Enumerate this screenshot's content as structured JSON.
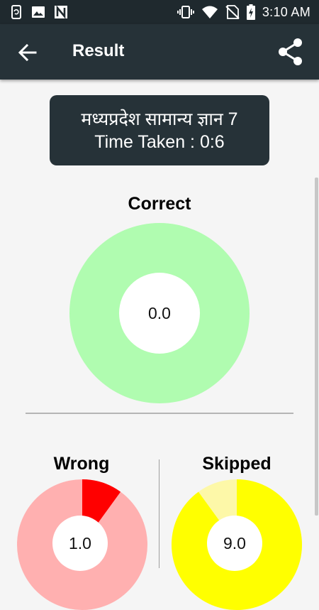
{
  "status_bar": {
    "time": "3:10 AM",
    "left_icons": [
      "phone-sync-icon",
      "image-icon",
      "n-icon"
    ],
    "right_icons": [
      "vibrate-icon",
      "wifi-icon",
      "no-sim-icon",
      "battery-charging-icon"
    ]
  },
  "app_bar": {
    "title": "Result",
    "back_icon": "arrow-back-icon",
    "share_icon": "share-icon"
  },
  "quiz_info": {
    "title": "मध्यप्रदेश सामान्य ज्ञान 7",
    "time_taken": "Time Taken : 0:6"
  },
  "results": {
    "correct": {
      "label": "Correct",
      "value": "0.0",
      "fraction": 0.0,
      "fill_color": "#b0fcb0",
      "accent_color": "#00ff00"
    },
    "wrong": {
      "label": "Wrong",
      "value": "1.0",
      "fraction": 0.1,
      "fill_color": "#ffb0b0",
      "accent_color": "#ff0000"
    },
    "skipped": {
      "label": "Skipped",
      "value": "9.0",
      "fraction": 0.9,
      "fill_color": "#fdf8a8",
      "accent_color": "#ffff00"
    }
  },
  "colors": {
    "app_bar": "#263238",
    "status_bar": "#1f292e",
    "background": "#f5f5f5"
  }
}
